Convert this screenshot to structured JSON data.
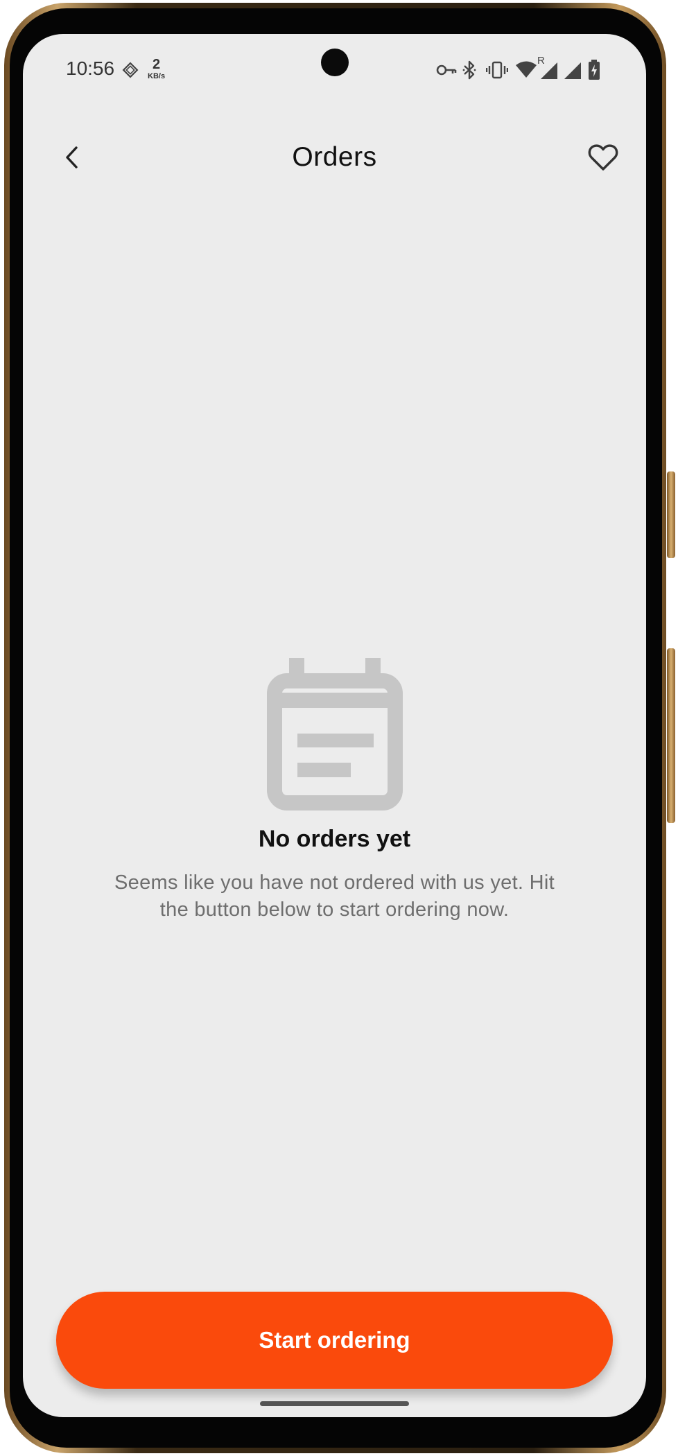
{
  "status_bar": {
    "time": "10:56",
    "net_speed_value": "2",
    "net_speed_unit": "KB/s",
    "network_type": "R",
    "icons": [
      "data-saver-icon",
      "vpn-key-icon",
      "bluetooth-icon",
      "vibrate-icon",
      "wifi-icon",
      "signal-icon",
      "signal-icon",
      "battery-charging-icon"
    ]
  },
  "header": {
    "title": "Orders",
    "back_icon": "back-arrow-icon",
    "favorite_icon": "heart-icon"
  },
  "empty_state": {
    "icon": "calendar-icon",
    "title": "No orders yet",
    "description": "Seems like you have not ordered with us yet. Hit the button below to start ordering now."
  },
  "cta": {
    "label": "Start ordering"
  },
  "colors": {
    "accent": "#FA4A0C",
    "background": "#ECECEC",
    "icon_muted": "#C6C6C6",
    "text_primary": "#111111",
    "text_secondary": "#6E6E6E"
  }
}
